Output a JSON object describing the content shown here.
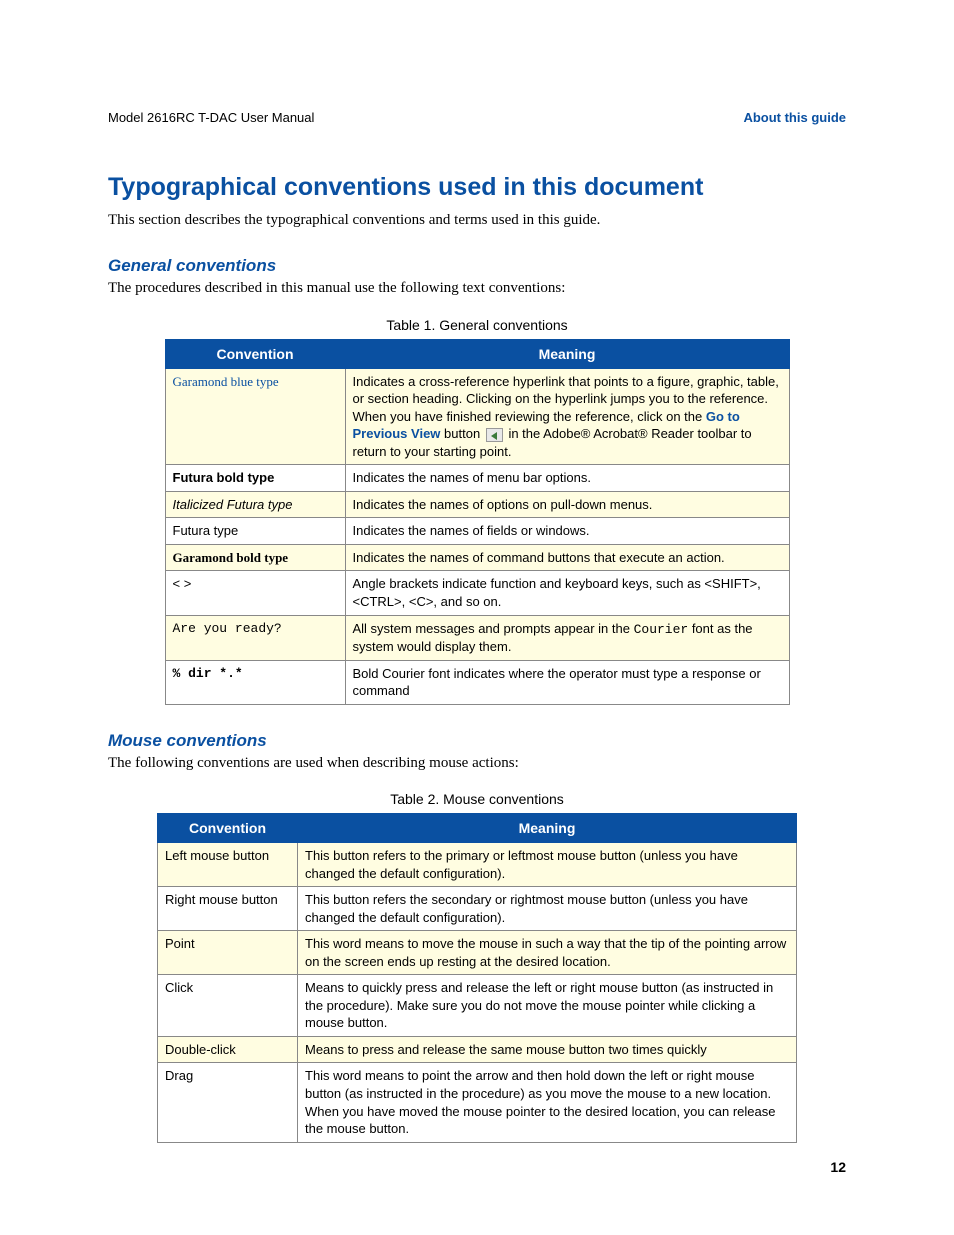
{
  "header": {
    "left": "Model 2616RC T-DAC User Manual",
    "right": "About this guide"
  },
  "main_heading": "Typographical conventions used in this document",
  "intro_para": "This section describes the typographical conventions and terms used in this guide.",
  "section1": {
    "heading": "General conventions",
    "para": "The procedures described in this manual use the following text conventions:",
    "table_caption": "Table 1. General conventions",
    "col1": "Convention",
    "col2": "Meaning",
    "rows": [
      {
        "conv": "Garamond blue type",
        "meaning_pre": "Indicates a cross-reference hyperlink that points to a figure, graphic, table, or section heading. Clicking on the hyperlink jumps you to the reference. When you have finished reviewing the reference, click on the ",
        "gotoprev": "Go to Previous View",
        "meaning_mid": " button ",
        "meaning_post": " in the Adobe® Acrobat® Reader toolbar to return to your starting point."
      },
      {
        "conv": "Futura bold type",
        "meaning": "Indicates the names of menu bar options."
      },
      {
        "conv": "Italicized Futura type",
        "meaning": "Indicates the names of options on pull-down menus."
      },
      {
        "conv": "Futura type",
        "meaning": "Indicates the names of fields or windows."
      },
      {
        "conv": "Garamond bold type",
        "meaning": "Indicates the names of command buttons that execute an action."
      },
      {
        "conv": "< >",
        "meaning": "Angle brackets indicate function and keyboard keys, such as <SHIFT>, <CTRL>, <C>, and so on."
      },
      {
        "conv": "Are you ready?",
        "meaning_pre": "All system messages and prompts appear in the ",
        "courier": "Courier",
        "meaning_post": " font as the system would display them."
      },
      {
        "conv": "% dir *.*",
        "meaning": "Bold Courier font indicates where the operator must type a response or command"
      }
    ]
  },
  "section2": {
    "heading": "Mouse conventions",
    "para": "The following conventions are used when describing mouse actions:",
    "table_caption": "Table 2. Mouse conventions",
    "col1": "Convention",
    "col2": "Meaning",
    "rows": [
      {
        "conv": "Left mouse button",
        "meaning": "This button refers to the primary or leftmost mouse button (unless you have changed the default configuration)."
      },
      {
        "conv": "Right mouse button",
        "meaning": "This button refers the secondary or rightmost mouse button (unless you have changed the default configuration)."
      },
      {
        "conv": "Point",
        "meaning": "This word means to move the mouse in such a way that the tip of the pointing arrow on the screen ends up resting at the desired location."
      },
      {
        "conv": "Click",
        "meaning": "Means to quickly press and release the left or right mouse button (as instructed in the procedure). Make sure you do not move the mouse pointer while clicking a mouse button."
      },
      {
        "conv": "Double-click",
        "meaning": "Means to press and release the same mouse button two times quickly"
      },
      {
        "conv": "Drag",
        "meaning": "This word means to point the arrow and then hold down the left or right mouse button (as instructed in the procedure) as you move the mouse to a new location. When you have moved the mouse pointer to the desired location, you can release the mouse button."
      }
    ]
  },
  "page_number": "12"
}
